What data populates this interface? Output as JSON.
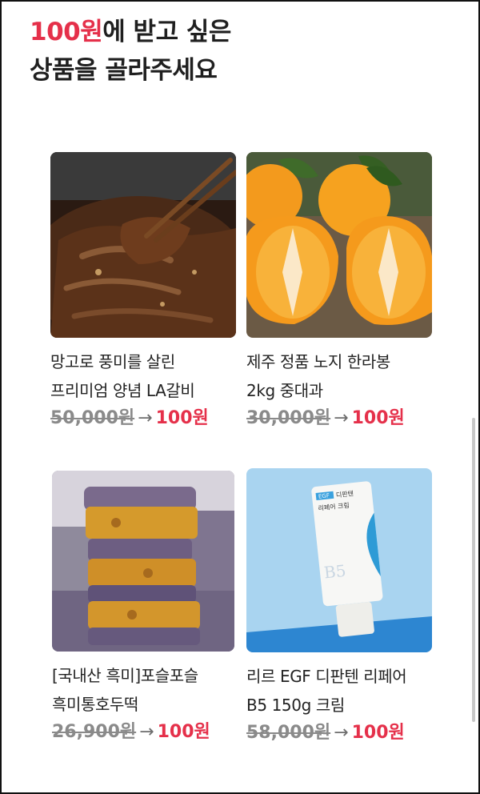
{
  "headline": {
    "accent": "100원",
    "line1_rest": "에 받고 싶은",
    "line2": "상품을 골라주세요"
  },
  "colors": {
    "accent": "#e5304a",
    "old_price": "#8a8a8a"
  },
  "products": [
    {
      "image": "marinated-beef-ribs-image",
      "title_line1": "망고로 풍미를 살린",
      "title_line2": "프리미엄 양념 LA갈비",
      "old_price": "50,000원",
      "arrow": "→",
      "new_price": "100원"
    },
    {
      "image": "hallabong-orange-image",
      "title_line1": "제주 정품 노지 한라봉",
      "title_line2": "2kg 중대과",
      "old_price": "30,000원",
      "arrow": "→",
      "new_price": "100원"
    },
    {
      "image": "black-rice-rice-cake-image",
      "title_line1": "[국내산 흑미]포슬포슬",
      "title_line2": "흑미통호두떡",
      "old_price": "26,900원",
      "arrow": "→",
      "new_price": "100원"
    },
    {
      "image": "cream-tube-image",
      "title_line1": "리르 EGF 디판텐 리페어",
      "title_line2": "B5 150g 크림",
      "old_price": "58,000원",
      "arrow": "→",
      "new_price": "100원",
      "tube_brand": "EGF",
      "tube_line1": "디판텐",
      "tube_line2": "리페어 크림",
      "tube_mark": "B5"
    }
  ]
}
